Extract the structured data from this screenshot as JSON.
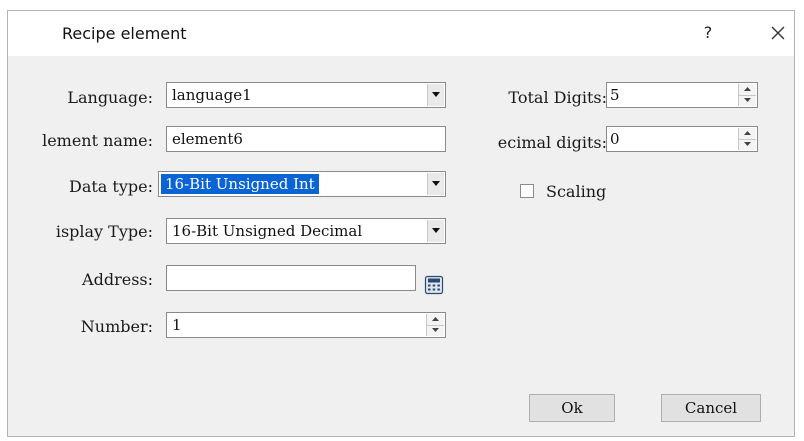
{
  "window": {
    "title": "Recipe element",
    "help_label": "?"
  },
  "form": {
    "language_label": "Language:",
    "language_value": "language1",
    "element_name_label": "lement name:",
    "element_name_value": "element6",
    "data_type_label": "Data type:",
    "data_type_value": "16-Bit Unsigned Int",
    "display_type_label": "isplay Type:",
    "display_type_value": "16-Bit Unsigned Decimal",
    "address_label": "Address:",
    "address_value": "",
    "number_label": "Number:",
    "number_value": "1",
    "total_digits_label": "Total Digits:",
    "total_digits_value": "5",
    "decimal_digits_label": "ecimal digits:",
    "decimal_digits_value": "0",
    "scaling_label": "Scaling",
    "scaling_checked": false
  },
  "buttons": {
    "ok": "Ok",
    "cancel": "Cancel"
  },
  "colors": {
    "selection": "#0a64d6",
    "dialog_bg": "#f0f0f0"
  },
  "icons": [
    "close-icon",
    "dropdown-arrow-icon",
    "spin-up-icon",
    "spin-down-icon",
    "calculator-icon",
    "checkbox-icon"
  ]
}
